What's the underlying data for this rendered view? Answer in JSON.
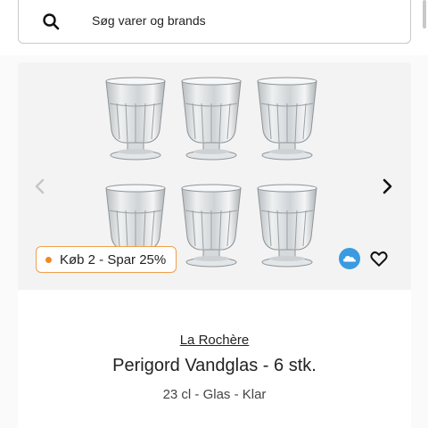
{
  "search": {
    "placeholder": "Søg varer og brands"
  },
  "product": {
    "promo_label": "Køb 2 - Spar 25%",
    "brand": "La Rochère",
    "name": "Perigord Vandglas - 6 stk.",
    "details": "23 cl - Glas - Klar"
  },
  "icons": {
    "search": "search-icon",
    "arrow_left": "chevron-left-icon",
    "arrow_right": "chevron-right-icon",
    "cloud": "cloud-icon",
    "heart": "heart-icon"
  },
  "colors": {
    "promo_border": "#f0a04b",
    "promo_dot": "#f08a24",
    "cloud_badge": "#3a9be0"
  }
}
